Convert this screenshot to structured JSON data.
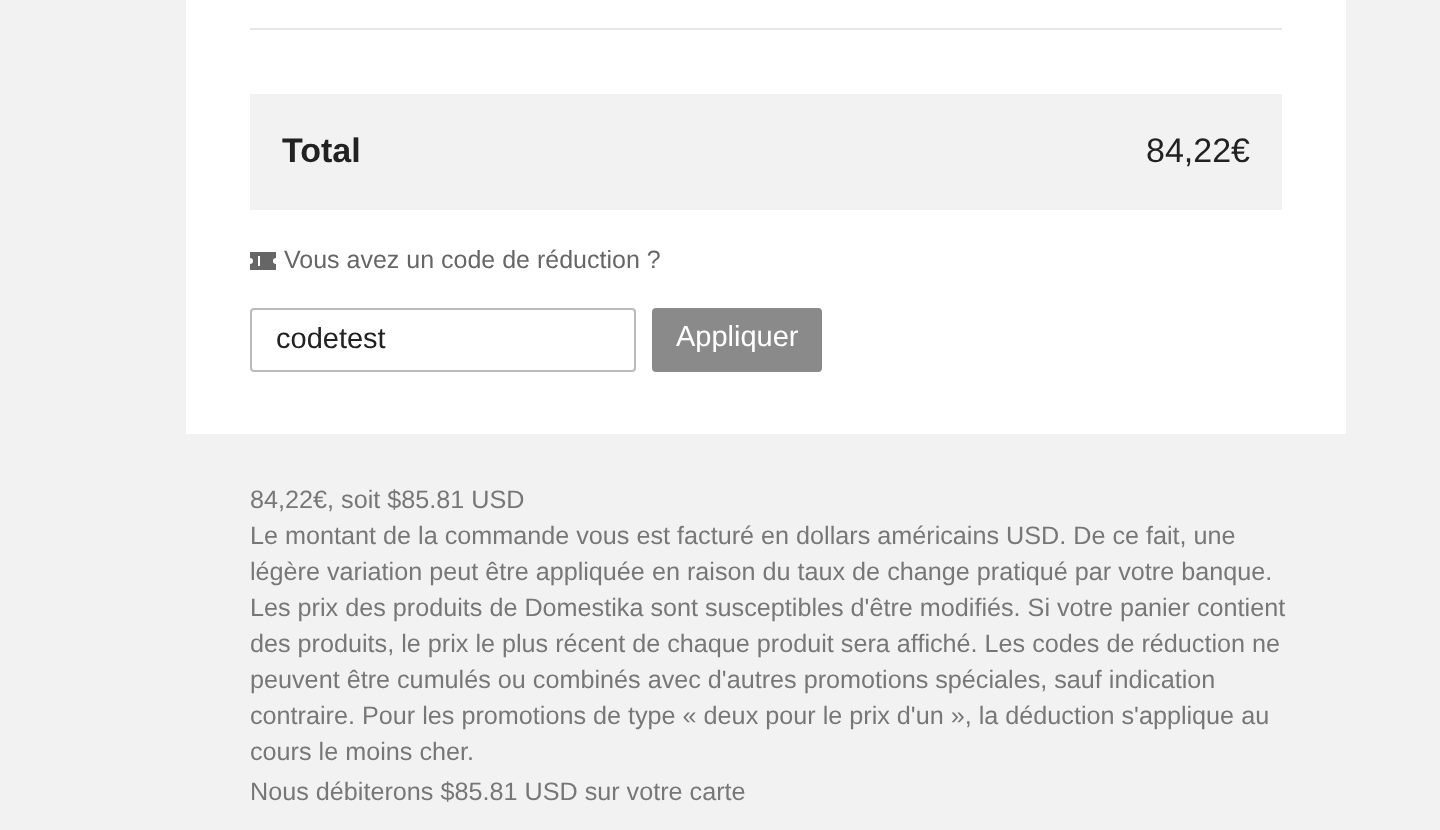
{
  "total": {
    "label": "Total",
    "amount": "84,22€"
  },
  "coupon": {
    "prompt": "Vous avez un code de réduction ?",
    "value": "codetest",
    "button": "Appliquer"
  },
  "conversion": "84,22€, soit $85.81 USD",
  "notice": "Le montant de la commande vous est facturé en dollars américains USD. De ce fait, une légère variation peut être appliquée en raison du taux de change pratiqué par votre banque. Les prix des produits de Domestika sont susceptibles d'être modifiés. Si votre panier contient des produits, le prix le plus récent de chaque produit sera affiché. Les codes de réduction ne peuvent être cumulés ou combinés avec d'autres promotions spéciales, sauf indication contraire. Pour les promotions de type « deux pour le prix d'un », la déduction s'applique au cours le moins cher.",
  "charge_note": "Nous débiterons $85.81 USD sur votre carte"
}
